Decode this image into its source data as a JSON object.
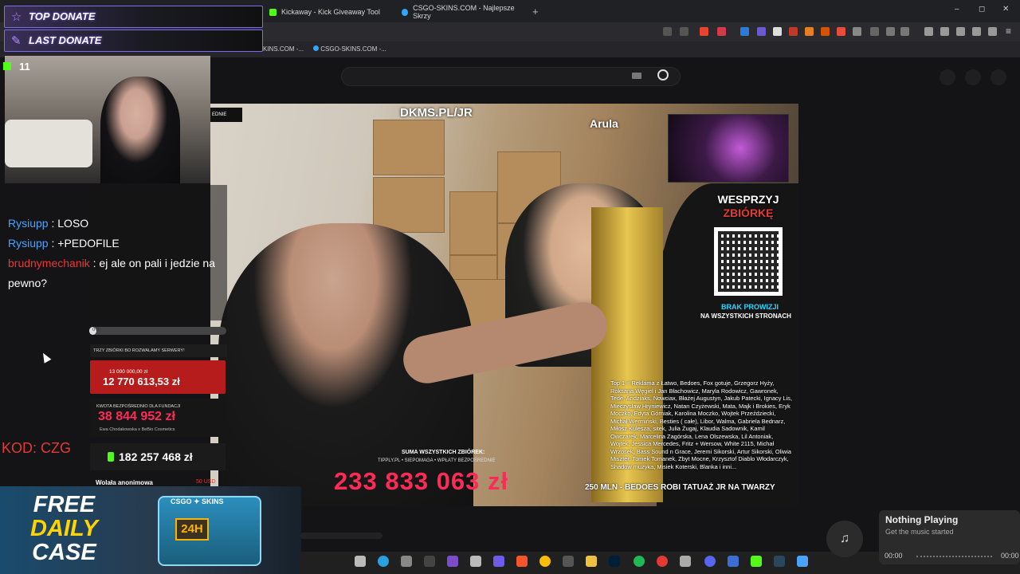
{
  "browser": {
    "tabs": [
      {
        "label": "Kickaway - Kick Giveaway Tool",
        "color": "#53fc18"
      },
      {
        "label": "CSGO-SKINS.COM - Najlepsze Skrzy",
        "color": "#2fa6ff"
      }
    ],
    "new_tab": "+",
    "bookmarks": [
      "KINS.COM -...",
      "CSGO-SKINS.COM -..."
    ],
    "window": {
      "minimize": "–",
      "maximize": "◻",
      "close": "✕"
    }
  },
  "overlay": {
    "top_donate": "TOP DONATE",
    "last_donate": "LAST DONATE",
    "viewers": "11",
    "kod": "KOD: CZG"
  },
  "chat": [
    {
      "user": "Rysiupp",
      "text": ": LOSO",
      "user_color": "#4aa3ff"
    },
    {
      "user": "Rysiupp",
      "text": ": +PEDOFILE",
      "user_color": "#4aa3ff"
    },
    {
      "user": "brudnymechanik",
      "text": ": ej ale on pali i jedzie na pewno?",
      "user_color": "#e53935"
    }
  ],
  "donations": {
    "progress_label": "0%",
    "progress_fraction": 0.05,
    "trzy": "TRZY ZBIÓRKI BO ROZWALAMY SERWERY!",
    "box1_small": "13 000 000,00 zł",
    "box1_big": "12 770 613,53 zł",
    "box2_small": "KWOTA BEZPOŚREDNIO DLA FUNDACJI",
    "box2_big": "38 844 952 zł",
    "box2_tiny": "Ewa Chodakowska x BeBio Cosmetics",
    "box3_big": "182 257 468 zł",
    "wplata": "Wolała anonimowa",
    "usd": "50 USD"
  },
  "stream": {
    "dkms": "DKMS.PL/JR",
    "arula": "Arula",
    "wesprzyj": "WESPRZYJ",
    "zbiorke": "ZBIÓRKĘ",
    "brak": "BRAK PROWIZJI",
    "wszystkich": "NA WSZYSTKICH STRONACH",
    "suma": "SUMA WSZYSTKICH ZBIÓREK:",
    "tipply": "TIPPLY.PL • SIEPOMAGA • WPŁATY BEZPOŚREDNIE",
    "amount": "233 833 063 zł",
    "mln": "250 MLN - BEDOES ROBI TATUAŻ JR NA TWARZY",
    "top1": "Top 1 = Reklama z Łatwo, Bedoes, Fox gotuje, Grzegorz Hyży, Roksana Węgiel i Jan Błachowicz, Maryla Rodowicz, Gawronek, Tede, Andziaks, Nowciax, Błażej Augustyn, Jakub Patecki, Ignacy Lis, Mieczysław Hryniewicz, Natan Czyżewski, Mata, Majk i Brokies, Eryk Moczko, Edyta Górniak, Karolina Moczko, Wojtek Przeździecki, Michał Wermiński, Besties ( całe), Libor, Walma, Gabriela Bednarz, Miłosz Kulesza, sitek, Julia Żugaj, Klaudia Sadownik, Kamil Owczarek, Marcelina Zagórska, Lena Olszewska, Lil Antoniak, Wojtek, Jessica Mercedes, Fritz + Wersow, White 2115, Michał Wrzosek, Bass Sound n Grace, Jeremi Sikorski, Artur Sikorski, Oliwia Miszter, Tomek Tomanek, Zbyt Mocne, Krzysztof Diablo Włodarczyk, Shadow muzyka, Misiek Koterski, Blanka i inni..."
  },
  "promo": {
    "free": "FREE",
    "daily": "DAILY",
    "case": "CASE",
    "chest_brand": "CSGO ✦ SKINS",
    "chest_24": "24H"
  },
  "media": {
    "title": "Nothing Playing",
    "subtitle": "Get the music started",
    "time_start": "00:00",
    "time_end": "00:00"
  },
  "colors": {
    "accent_green": "#53fc18",
    "donate_red": "#ff2b57"
  }
}
